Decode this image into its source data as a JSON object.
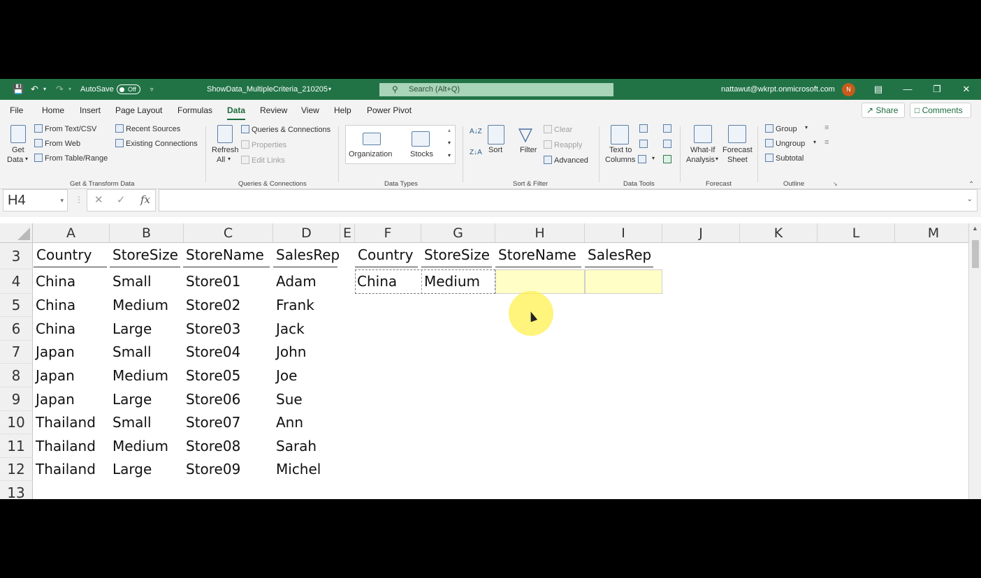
{
  "titlebar": {
    "autosave_label": "AutoSave",
    "autosave_state": "Off",
    "document_title": "ShowData_MultipleCriteria_210205",
    "search_placeholder": "Search (Alt+Q)",
    "account": "nattawut@wkrpt.onmicrosoft.com",
    "avatar_initial": "N"
  },
  "menu": {
    "tabs": [
      "File",
      "Home",
      "Insert",
      "Page Layout",
      "Formulas",
      "Data",
      "Review",
      "View",
      "Help",
      "Power Pivot"
    ],
    "active_tab": "Data",
    "share": "Share",
    "comments": "Comments"
  },
  "ribbon": {
    "get_data": [
      "Get",
      "Data"
    ],
    "from_text": "From Text/CSV",
    "from_web": "From Web",
    "from_table": "From Table/Range",
    "recent_sources": "Recent Sources",
    "existing_connections": "Existing Connections",
    "group_get_transform": "Get & Transform Data",
    "refresh": [
      "Refresh",
      "All"
    ],
    "queries_connections": "Queries & Connections",
    "properties": "Properties",
    "edit_links": "Edit Links",
    "group_queries": "Queries & Connections",
    "organization": "Organization",
    "stocks": "Stocks",
    "group_data_types": "Data Types",
    "sort": "Sort",
    "filter": "Filter",
    "clear": "Clear",
    "reapply": "Reapply",
    "advanced": "Advanced",
    "group_sort_filter": "Sort & Filter",
    "text_to_columns": [
      "Text to",
      "Columns"
    ],
    "group_data_tools": "Data Tools",
    "what_if": [
      "What-If",
      "Analysis"
    ],
    "forecast_sheet": [
      "Forecast",
      "Sheet"
    ],
    "group_forecast": "Forecast",
    "group": "Group",
    "ungroup": "Ungroup",
    "subtotal": "Subtotal",
    "group_outline": "Outline"
  },
  "formula_bar": {
    "name_box": "H4",
    "cancel": "✕",
    "enter": "✓",
    "fx": "fx",
    "formula": ""
  },
  "grid": {
    "columns": [
      "A",
      "B",
      "C",
      "D",
      "E",
      "F",
      "G",
      "H",
      "I",
      "J",
      "K",
      "L",
      "M"
    ],
    "rows": [
      "3",
      "4",
      "5",
      "6",
      "7",
      "8",
      "9",
      "10",
      "11",
      "12",
      "13"
    ],
    "data_header": [
      "Country",
      "StoreSize",
      "StoreName",
      "SalesRep"
    ],
    "data_rows": [
      [
        "China",
        "Small",
        "Store01",
        "Adam"
      ],
      [
        "China",
        "Medium",
        "Store02",
        "Frank"
      ],
      [
        "China",
        "Large",
        "Store03",
        "Jack"
      ],
      [
        "Japan",
        "Small",
        "Store04",
        "John"
      ],
      [
        "Japan",
        "Medium",
        "Store05",
        "Joe"
      ],
      [
        "Japan",
        "Large",
        "Store06",
        "Sue"
      ],
      [
        "Thailand",
        "Small",
        "Store07",
        "Ann"
      ],
      [
        "Thailand",
        "Medium",
        "Store08",
        "Sarah"
      ],
      [
        "Thailand",
        "Large",
        "Store09",
        "Michel"
      ]
    ],
    "criteria_header": [
      "Country",
      "StoreSize",
      "StoreName",
      "SalesRep"
    ],
    "criteria_values": [
      "China",
      "Medium"
    ],
    "active_cell": "H4",
    "criteria_fill_color": "#fffec6"
  },
  "colors": {
    "brand": "#217346",
    "accent": "#1e6b3e"
  }
}
